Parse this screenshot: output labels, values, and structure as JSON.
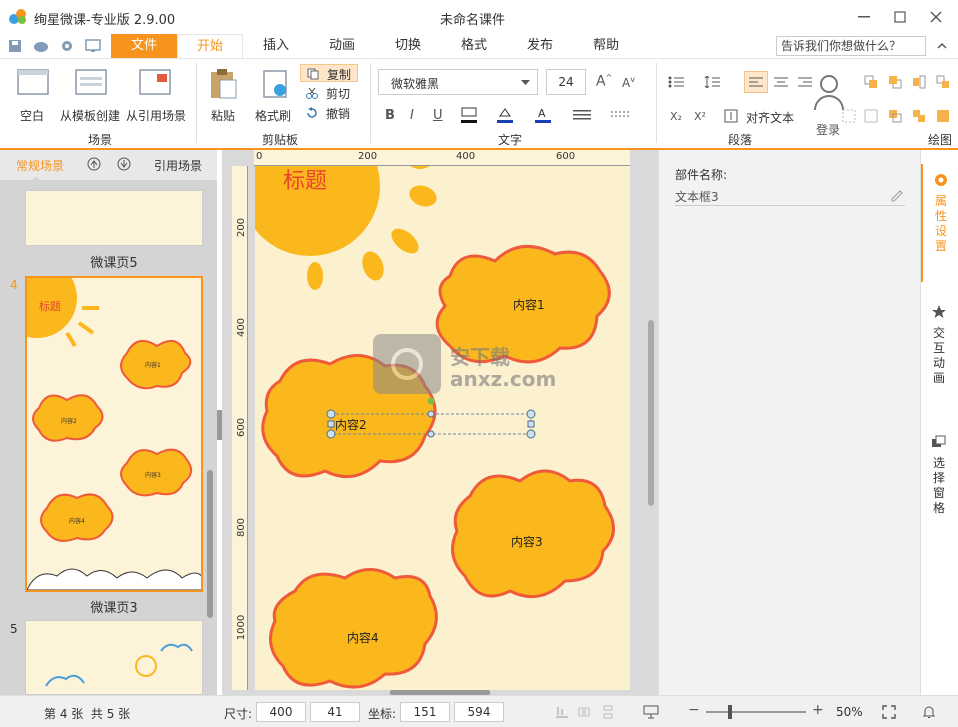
{
  "window": {
    "app_title": "绚星微课-专业版 2.9.00",
    "doc_title": "未命名课件"
  },
  "tabs": [
    {
      "label": "文件"
    },
    {
      "label": "开始"
    },
    {
      "label": "插入"
    },
    {
      "label": "动画"
    },
    {
      "label": "切换"
    },
    {
      "label": "格式"
    },
    {
      "label": "发布"
    },
    {
      "label": "帮助"
    }
  ],
  "search": {
    "placeholder": "告诉我们你想做什么？"
  },
  "ribbon": {
    "scene": {
      "blank": "空白",
      "from_template": "从模板创建",
      "from_ref": "从引用场景",
      "group": "场景"
    },
    "clipboard": {
      "paste": "粘贴",
      "format_painter": "格式刷",
      "copy": "复制",
      "cut": "剪切",
      "undo": "撤销",
      "group": "剪贴板"
    },
    "text": {
      "font": "微软雅黑",
      "size": "24",
      "bold": "B",
      "italic": "I",
      "underline": "U",
      "group": "文字"
    },
    "paragraph": {
      "align_text": "对齐文本",
      "group": "段落"
    },
    "login": "登录",
    "drawing": {
      "group": "绘图"
    }
  },
  "left_panel": {
    "tab_regular": "常规场景",
    "tab_ref": "引用场景",
    "slides": [
      {
        "number": "",
        "label": "微课页5"
      },
      {
        "number": "4",
        "label": "微课页3",
        "title": "标题",
        "items": [
          "内容1",
          "内容2",
          "内容3",
          "内容4"
        ]
      },
      {
        "number": "5",
        "label": ""
      }
    ]
  },
  "canvas": {
    "ruler_top": [
      "0",
      "200",
      "400",
      "600"
    ],
    "ruler_left": [
      "200",
      "400",
      "600",
      "800",
      "1000"
    ],
    "slide_title": "标题",
    "items": [
      "内容1",
      "内容2",
      "内容3",
      "内容4"
    ],
    "watermark": "安下载 anxz.com"
  },
  "properties": {
    "name_label": "部件名称:",
    "name_value": "文本框3"
  },
  "side_tabs": [
    {
      "label": "属性设置",
      "icon": "gear-icon"
    },
    {
      "label": "交互动画",
      "icon": "star-icon"
    },
    {
      "label": "选择窗格",
      "icon": "layers-icon"
    }
  ],
  "status": {
    "page_info": "第 4 张  共 5 张",
    "size_label": "尺寸:",
    "width": "400",
    "height": "41",
    "coord_label": "坐标:",
    "x": "151",
    "y": "594",
    "zoom": "50%",
    "zoom_minus": "−",
    "zoom_plus": "+"
  },
  "colors": {
    "accent": "#f7941d",
    "cloud_fill": "#fbb81d",
    "cloud_stroke": "#ee5a3a",
    "title_red": "#e8452c",
    "slide_bg": "#fcf1cf"
  }
}
